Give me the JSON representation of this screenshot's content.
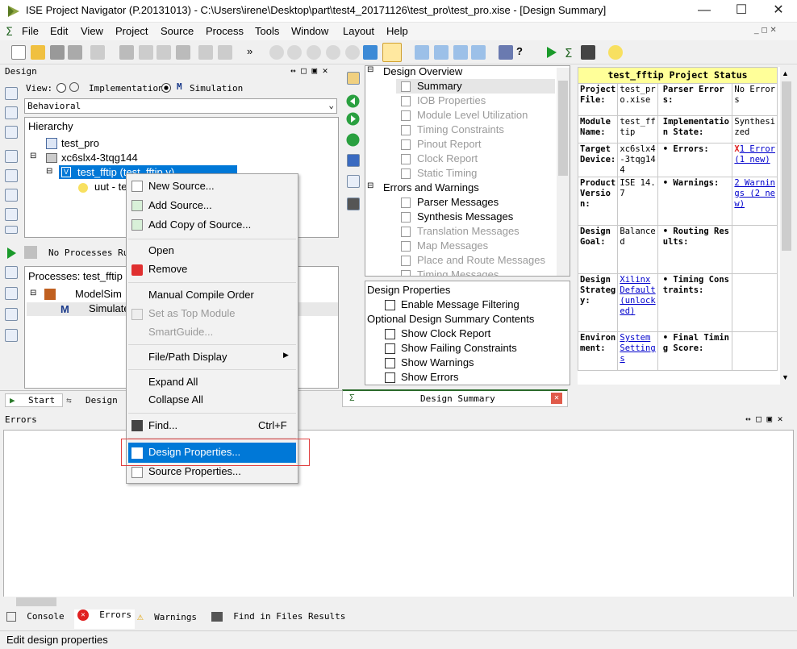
{
  "window": {
    "title": "ISE Project Navigator (P.20131013) - C:\\Users\\irene\\Desktop\\part\\test4_20171126\\test_pro\\test_pro.xise - [Design Summary]"
  },
  "menubar": [
    "File",
    "Edit",
    "View",
    "Project",
    "Source",
    "Process",
    "Tools",
    "Window",
    "Layout",
    "Help"
  ],
  "design_panel": {
    "title": "Design",
    "view_label": "View:",
    "implementation": "Implementation",
    "simulation": "Simulation",
    "behavior_select": "Behavioral",
    "hierarchy_label": "Hierarchy",
    "tree": [
      "test_pro",
      "xc6slx4-3tqg144",
      "test_fftip (test_fftip.v)",
      "uut - te"
    ],
    "no_processes": "No Processes Running",
    "processes_label": "Processes: test_fftip",
    "process_items": [
      "ModelSim",
      "Simulate"
    ],
    "tabs": [
      "Start",
      "Design"
    ]
  },
  "context_menu": {
    "items": [
      "New Source...",
      "Add Source...",
      "Add Copy of Source...",
      "Open",
      "Remove",
      "Manual Compile Order",
      "Set as Top Module",
      "SmartGuide...",
      "File/Path Display",
      "Expand All",
      "Collapse All",
      "Find...",
      "Design Properties...",
      "Source Properties..."
    ],
    "find_shortcut": "Ctrl+F"
  },
  "overview": {
    "design_overview": "Design Overview",
    "items": [
      "Summary",
      "IOB Properties",
      "Module Level Utilization",
      "Timing Constraints",
      "Pinout Report",
      "Clock Report",
      "Static Timing"
    ],
    "errors_warnings": "Errors and Warnings",
    "ew_items": [
      "Parser Messages",
      "Synthesis Messages",
      "Translation Messages",
      "Map Messages",
      "Place and Route Messages",
      "Timing Messages"
    ],
    "design_properties": "Design Properties",
    "enable_filter": "Enable Message Filtering",
    "optional": "Optional Design Summary Contents",
    "opt_items": [
      "Show Clock Report",
      "Show Failing Constraints",
      "Show Warnings",
      "Show Errors"
    ],
    "tab": "Design Summary"
  },
  "status_table": {
    "title": "test_fftip Project Status",
    "rows": [
      [
        "Project File:",
        "test_pro.xise",
        "Parser Errors:",
        "No Errors"
      ],
      [
        "Module Name:",
        "test_fftip",
        "Implementation State:",
        "Synthesized"
      ],
      [
        "Target Device:",
        "xc6slx4-3tqg144",
        "• Errors:",
        "1 Error (1 new)"
      ],
      [
        "Product Version:",
        "ISE 14.7",
        "• Warnings:",
        "2 Warnings (2 new)"
      ],
      [
        "Design Goal:",
        "Balanced",
        "• Routing Results:",
        ""
      ],
      [
        "Design Strategy:",
        "Xilinx Default (unlocked)",
        "• Timing Constraints:",
        ""
      ],
      [
        "Environment:",
        "System Settings",
        "• Final Timing Score:",
        ""
      ]
    ]
  },
  "errors_panel": {
    "title": "Errors"
  },
  "bottom_tabs": [
    "Console",
    "Errors",
    "Warnings",
    "Find in Files Results"
  ],
  "statusbar": "Edit design properties",
  "colors": {
    "highlight": "#0078d7",
    "status_header": "#ffff99",
    "menu_border_red": "#e04040"
  }
}
